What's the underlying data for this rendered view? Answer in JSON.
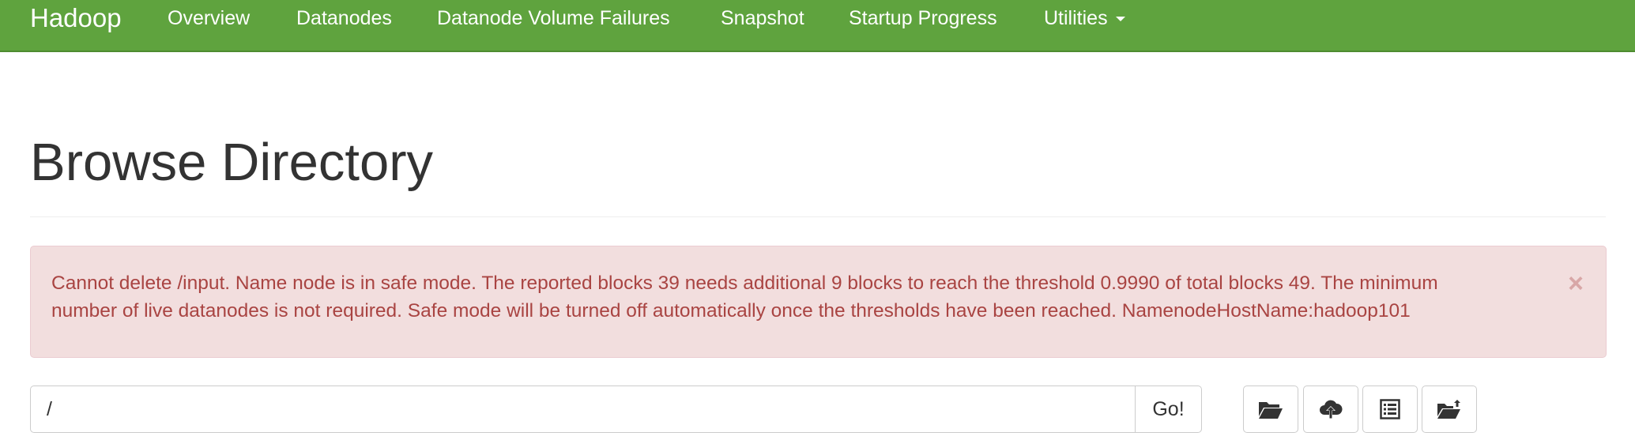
{
  "navbar": {
    "brand": "Hadoop",
    "items": [
      {
        "label": "Overview"
      },
      {
        "label": "Datanodes"
      },
      {
        "label": "Datanode Volume Failures"
      },
      {
        "label": "Snapshot"
      },
      {
        "label": "Startup Progress"
      },
      {
        "label": "Utilities"
      }
    ]
  },
  "page": {
    "title": "Browse Directory"
  },
  "alert": {
    "line1": "Cannot delete /input. Name node is in safe mode. The reported blocks 39 needs additional 9 blocks to reach the threshold 0.9990 of total blocks 49. The minimum",
    "line2": "number of live datanodes is not required. Safe mode will be turned off automatically once the thresholds have been reached. NamenodeHostName:hadoop101",
    "close_glyph": "×"
  },
  "browse": {
    "path_value": "/",
    "go_label": "Go!",
    "icons": [
      "folder-open-icon",
      "cloud-upload-icon",
      "list-icon",
      "folder-upload-icon"
    ]
  },
  "colors": {
    "navbar_bg": "#5fa33e",
    "alert_bg": "#f2dede",
    "alert_text": "#a94442"
  }
}
